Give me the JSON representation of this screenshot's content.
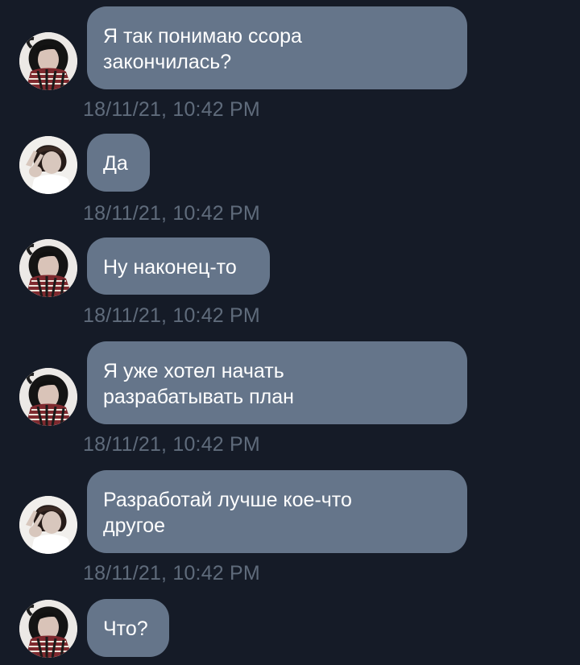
{
  "messages": [
    {
      "sender_avatar": "avatar-dark-hair-tapestry-shirt",
      "text": "Я так понимаю ссора\nзакончилась?",
      "timestamp": "18/11/21, 10:42 PM"
    },
    {
      "sender_avatar": "avatar-peace-sign-white-shirt",
      "text": "Да",
      "timestamp": "18/11/21, 10:42 PM"
    },
    {
      "sender_avatar": "avatar-dark-hair-tapestry-shirt",
      "text": "Ну наконец-то",
      "timestamp": "18/11/21, 10:42 PM"
    },
    {
      "sender_avatar": "avatar-dark-hair-tapestry-shirt",
      "text": "Я уже хотел начать\nразрабатывать план",
      "timestamp": "18/11/21, 10:42 PM"
    },
    {
      "sender_avatar": "avatar-peace-sign-white-shirt",
      "text": "Разработай лучше кое-что\nдругое",
      "timestamp": "18/11/21, 10:42 PM"
    },
    {
      "sender_avatar": "avatar-dark-hair-tapestry-shirt",
      "text": "Что?",
      "timestamp": ""
    }
  ],
  "colors": {
    "background": "#151b27",
    "bubble": "#65758a",
    "bubble_text": "#ffffff",
    "timestamp": "#5f6b7b"
  }
}
